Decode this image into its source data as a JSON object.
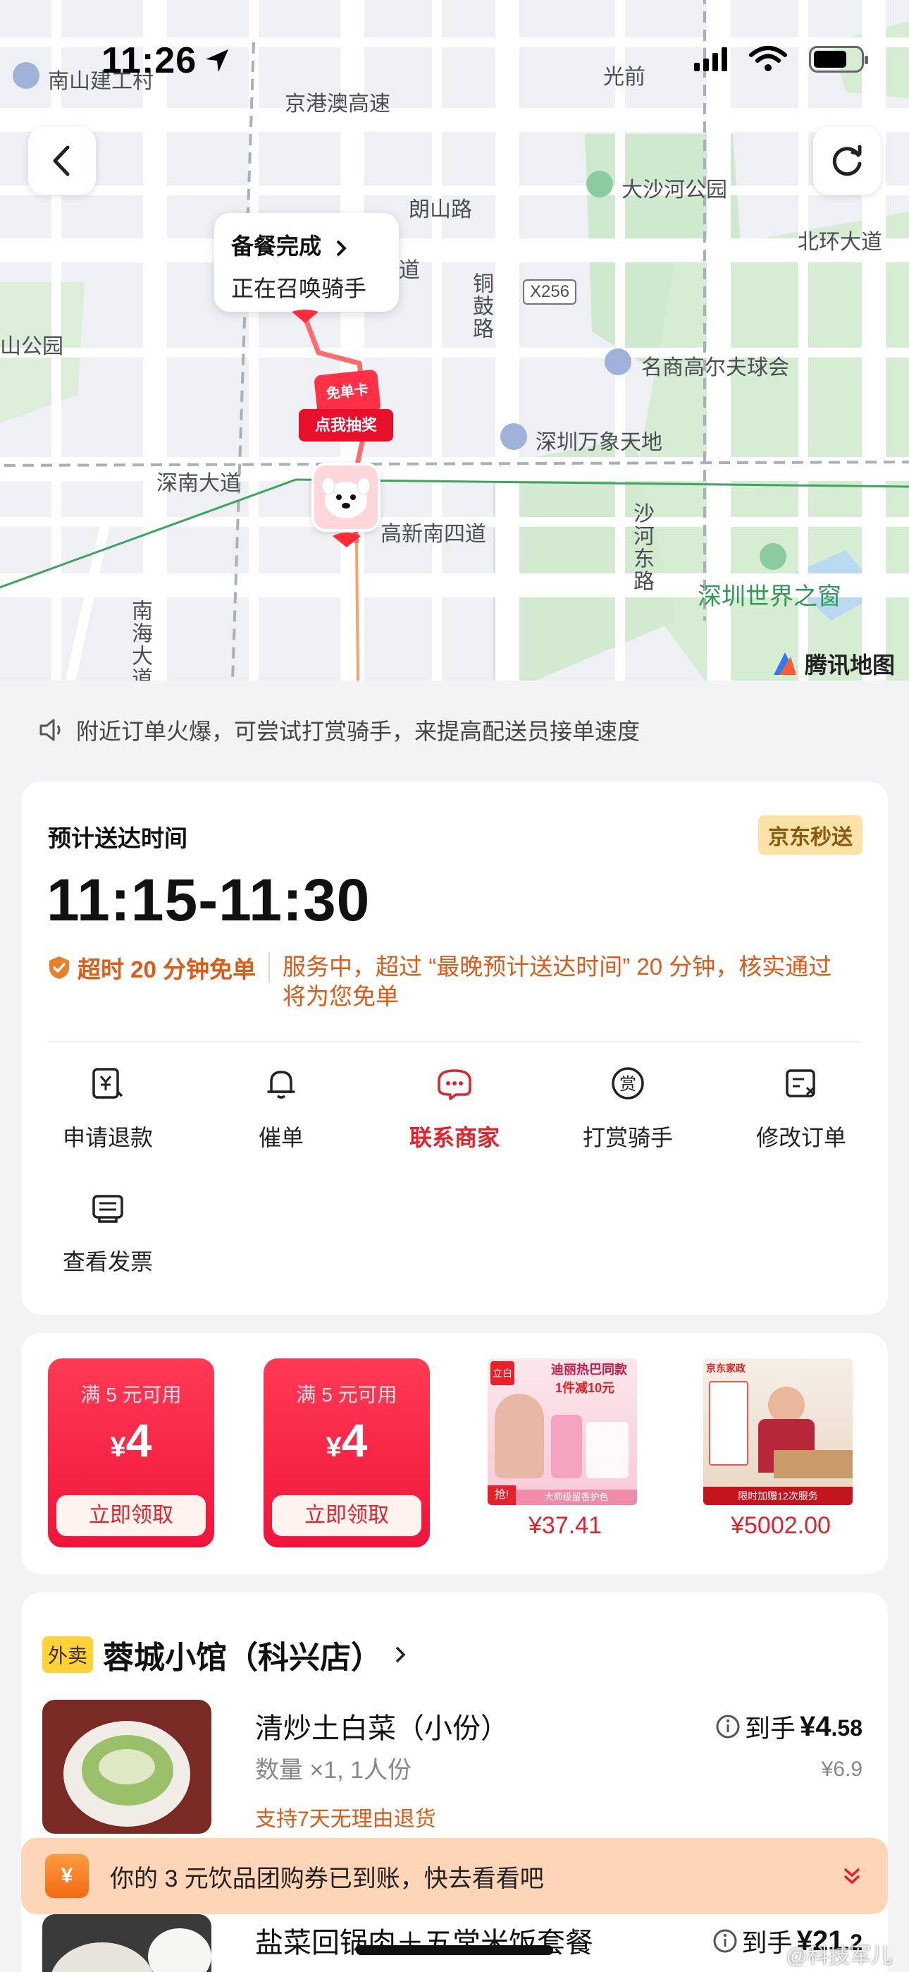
{
  "status_bar": {
    "time": "11:26"
  },
  "map": {
    "labels": {
      "nanshan": "南山建工村",
      "jinggangao": "京港澳高速",
      "guangqian": "光前",
      "langshan": "朗山路",
      "dashahe": "大沙河公园",
      "beihuan": "北环大道",
      "dao": "道",
      "tonggu": "铜鼓路",
      "x256": "X256",
      "shangongyuan": "山公园",
      "mingshang": "名商高尔夫球会",
      "wanxiang": "深圳万象天地",
      "shennan": "深南大道",
      "gaoxin": "高新南四道",
      "shahedong": "沙河东路",
      "window": "深圳世界之窗",
      "nanhai": "南海大道",
      "tencent": "腾讯地图"
    },
    "bubble": {
      "line1": "备餐完成",
      "line2": "正在召唤骑手"
    },
    "sticker": {
      "top": "免单卡",
      "bottom": "点我抽奖"
    }
  },
  "notice": "附近订单火爆，可尝试打赏骑手，来提高配送员接单速度",
  "delivery": {
    "eta_label": "预计送达时间",
    "badge": "京东秒送",
    "eta": "11:15-11:30",
    "guarantee_title": "超时 20 分钟免单",
    "guarantee_text": "服务中，超过 “最晚预计送达时间” 20 分钟，核实通过将为您免单",
    "actions": [
      {
        "label": "申请退款",
        "icon": "refund-icon"
      },
      {
        "label": "催单",
        "icon": "bell-icon"
      },
      {
        "label": "联系商家",
        "icon": "chat-icon"
      },
      {
        "label": "打赏骑手",
        "icon": "reward-icon"
      },
      {
        "label": "修改订单",
        "icon": "edit-order-icon"
      },
      {
        "label": "查看发票",
        "icon": "invoice-icon"
      }
    ]
  },
  "promo": {
    "coupons": [
      {
        "condition": "满 5 元可用",
        "symbol": "¥",
        "amount": "4",
        "button": "立即领取"
      },
      {
        "condition": "满 5 元可用",
        "symbol": "¥",
        "amount": "4",
        "button": "立即领取"
      }
    ],
    "products": [
      {
        "price": "¥37.41",
        "tag": "抢!",
        "headline": "迪丽热巴同款",
        "sub": "1件减10元",
        "caption": "大师级留香护色",
        "brand": "立白"
      },
      {
        "price": "¥5002.00",
        "brand": "京东家政",
        "caption": "限时加赠12次服务"
      }
    ]
  },
  "order": {
    "tag": "外卖",
    "shop_name": "蓉城小馆（科兴店）",
    "items": [
      {
        "name": "清炒土白菜（小份）",
        "qty": "数量 ×1, 1人份",
        "refund": "支持7天无理由退货",
        "net_label": "到手",
        "net_symbol": "¥",
        "net_int": "4",
        "net_dec": ".58",
        "orig": "¥6.9"
      },
      {
        "name": "盐菜回锅肉＋五常米饭套餐",
        "net_label": "到手",
        "net_symbol": "¥",
        "net_int": "21",
        "net_dec": ".2"
      }
    ]
  },
  "toast": {
    "icon": "¥",
    "message": "你的 3 元饮品团购券已到账，快去看看吧"
  },
  "watermark": "@科技军儿",
  "colors": {
    "accent_red": "#e8202a",
    "accent_orange": "#e05a14",
    "map_route": "#ff6b6b"
  }
}
